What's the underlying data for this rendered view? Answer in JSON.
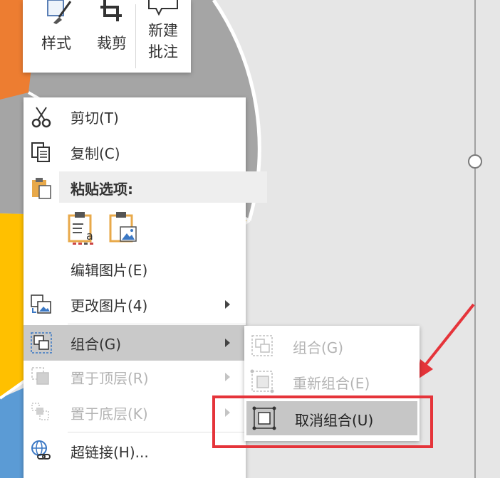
{
  "toolbar": {
    "style_label": "样式",
    "crop_label": "裁剪",
    "comment_line1": "新建",
    "comment_line2": "批注"
  },
  "context_menu": {
    "cut": "剪切(T)",
    "copy": "复制(C)",
    "paste_options": "粘贴选项:",
    "edit_picture": "编辑图片(E)",
    "change_picture": "更改图片(4)",
    "group": "组合(G)",
    "bring_to_front": "置于顶层(R)",
    "send_to_back": "置于底层(K)",
    "hyperlink": "超链接(H)..."
  },
  "submenu": {
    "group": "组合(G)",
    "regroup": "重新组合(E)",
    "ungroup": "取消组合(U)"
  },
  "colors": {
    "highlight_box": "#e5343a",
    "arrow": "#e5343a",
    "menu_selected": "#c9c9c9",
    "pie_orange": "#ed7d31",
    "pie_gray": "#a5a5a5",
    "pie_yellow": "#ffc000",
    "pie_blue": "#5b9bd5"
  }
}
